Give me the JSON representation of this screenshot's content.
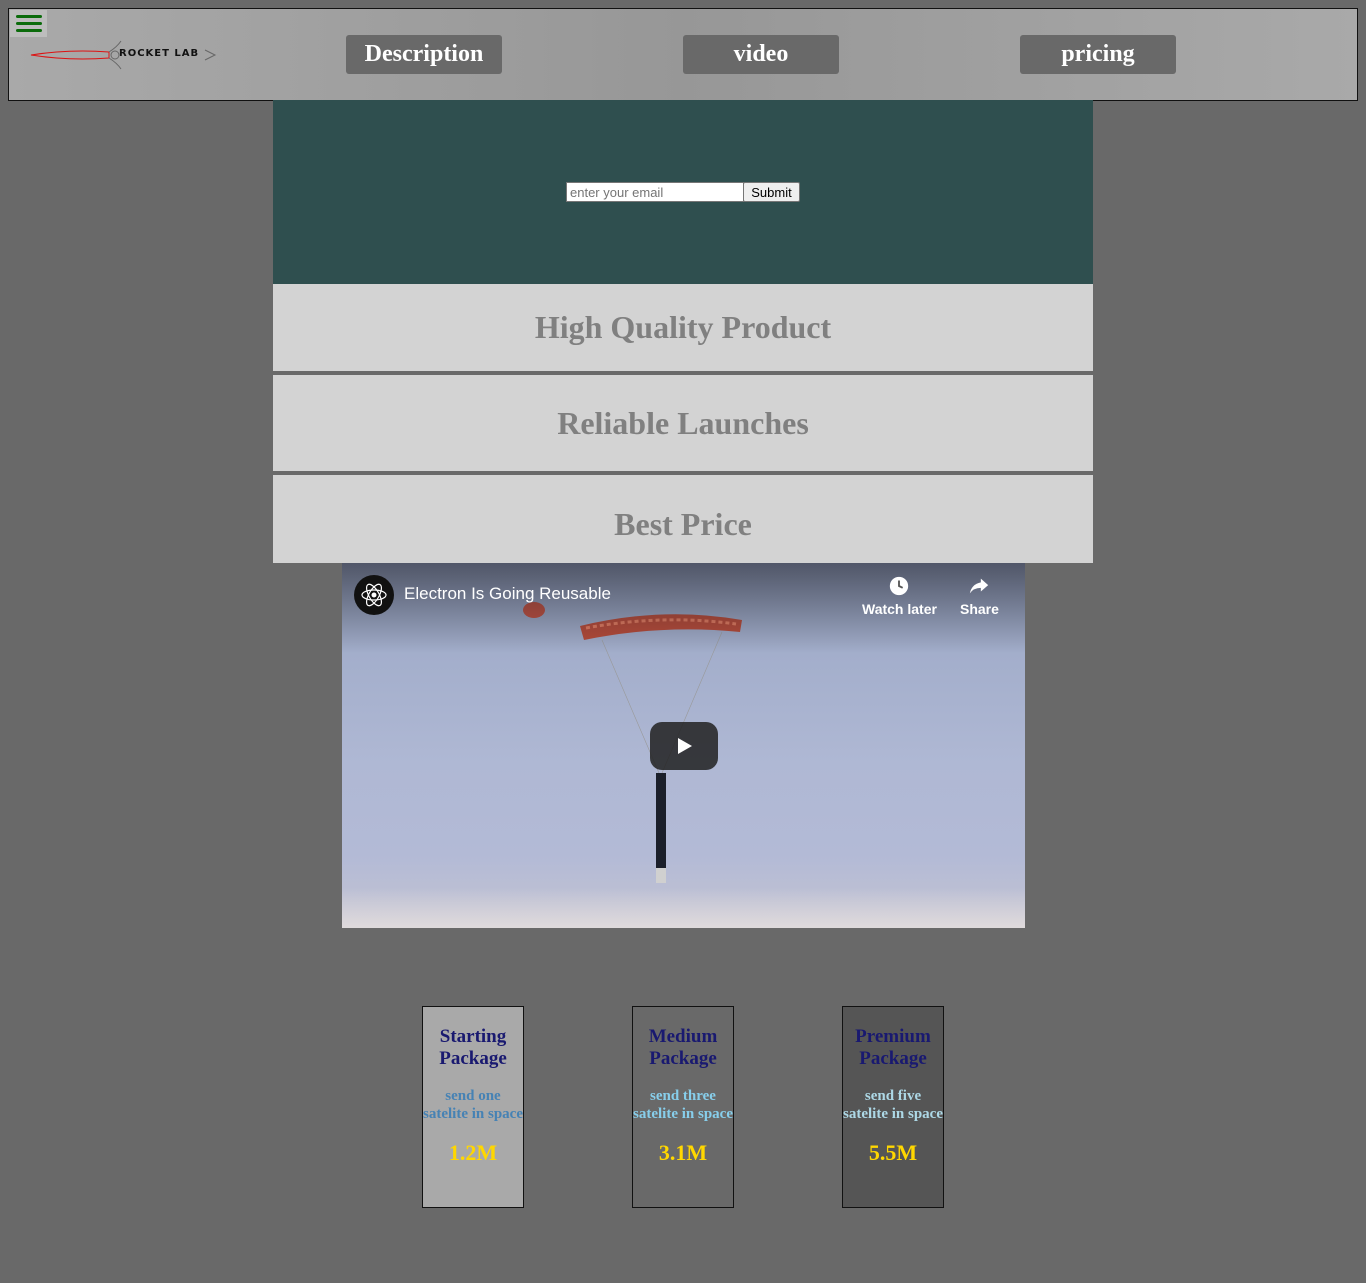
{
  "header": {
    "logo_text": "ROCKET LAB",
    "nav": [
      "Description",
      "video",
      "pricing"
    ]
  },
  "hero": {
    "email_placeholder": "enter your email",
    "submit_label": "Submit"
  },
  "features": [
    "High Quality Product",
    "Reliable Launches",
    "Best Price"
  ],
  "video": {
    "title": "Electron Is Going Reusable",
    "watch_later": "Watch later",
    "share": "Share"
  },
  "pricing": [
    {
      "title": "Starting Package",
      "desc": "send one satelite in space",
      "price": "1.2M",
      "bg": "#a9a9a9",
      "desc_color": "#4682b4"
    },
    {
      "title": "Medium Package",
      "desc": "send three satelite in space",
      "price": "3.1M",
      "bg": "#696969",
      "desc_color": "#87ceeb"
    },
    {
      "title": "Premium Package",
      "desc": "send five satelite in space",
      "price": "5.5M",
      "bg": "#555555",
      "desc_color": "#add8e6"
    }
  ],
  "colors": {
    "page_bg": "#696969",
    "hero_bg": "#2f4f4f",
    "feature_bg": "#d3d3d3",
    "nav_btn_bg": "#696969",
    "price_color": "#ffd700",
    "card_title_color": "#191970",
    "hamburger_color": "#0b6b0b"
  },
  "icons": [
    "menu-icon",
    "rocket-lab-logo",
    "atom-icon",
    "clock-icon",
    "share-icon",
    "play-icon"
  ]
}
